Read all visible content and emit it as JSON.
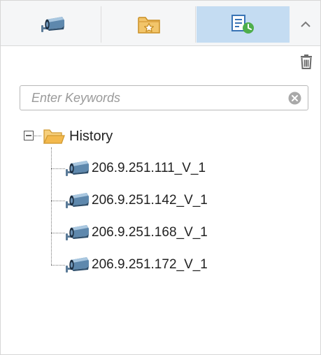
{
  "tabs": [
    {
      "icon": "camera-icon",
      "selected": false
    },
    {
      "icon": "favorite-folder-icon",
      "selected": false
    },
    {
      "icon": "history-list-icon",
      "selected": true
    }
  ],
  "search": {
    "placeholder": "Enter Keywords",
    "value": ""
  },
  "tree": {
    "root": {
      "label": "History",
      "expanded": true,
      "icon": "folder-open-icon"
    },
    "items": [
      {
        "label": "206.9.251.111_V_1",
        "icon": "camera-icon"
      },
      {
        "label": "206.9.251.142_V_1",
        "icon": "camera-icon"
      },
      {
        "label": "206.9.251.168_V_1",
        "icon": "camera-icon"
      },
      {
        "label": "206.9.251.172_V_1",
        "icon": "camera-icon"
      }
    ]
  },
  "colors": {
    "selected_tab": "#c4dcf2",
    "tabbar_bg": "#f5f6f7",
    "folder": "#f0b94a",
    "camera": "#4a6f8f"
  }
}
